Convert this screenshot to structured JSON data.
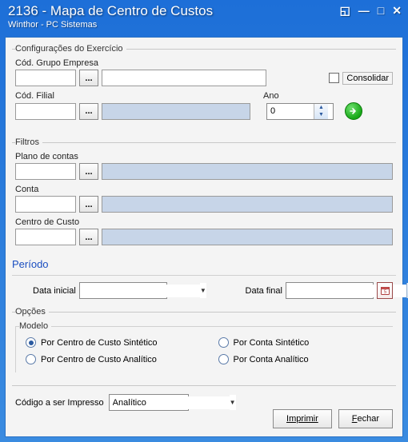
{
  "window": {
    "title": "2136 - Mapa de Centro de Custos",
    "subtitle": "Winthor - PC Sistemas"
  },
  "exercicio": {
    "legend": "Configurações do Exercício",
    "grupo_label": "Cód. Grupo Empresa",
    "grupo_code": "",
    "grupo_name": "",
    "consolidar_label": "Consolidar",
    "filial_label": "Cód. Filial",
    "filial_code": "",
    "filial_name": "",
    "ano_label": "Ano",
    "ano_value": "0"
  },
  "filtros": {
    "legend": "Filtros",
    "plano_label": "Plano de contas",
    "plano_code": "",
    "plano_name": "",
    "conta_label": "Conta",
    "conta_code": "",
    "conta_name": "",
    "centro_label": "Centro de Custo",
    "centro_code": "",
    "centro_name": ""
  },
  "periodo": {
    "legend": "Período",
    "inicial_label": "Data inicial",
    "inicial_value": "",
    "final_label": "Data final",
    "final_value": ""
  },
  "opcoes": {
    "legend": "Opções",
    "modelo_label": "Modelo",
    "options": {
      "sintetico_cc": "Por Centro de Custo Sintético",
      "analitico_cc": "Por Centro de Custo Analítico",
      "sintetico_conta": "Por Conta Sintético",
      "analitico_conta": "Por Conta Analítico"
    },
    "selected": "sintetico_cc"
  },
  "codigo_impresso": {
    "label": "Código a ser Impresso",
    "value": "Analítico"
  },
  "footer": {
    "imprimir": "Imprimir",
    "fechar_prefix": "F",
    "fechar_suffix": "echar"
  },
  "ellipsis": "..."
}
